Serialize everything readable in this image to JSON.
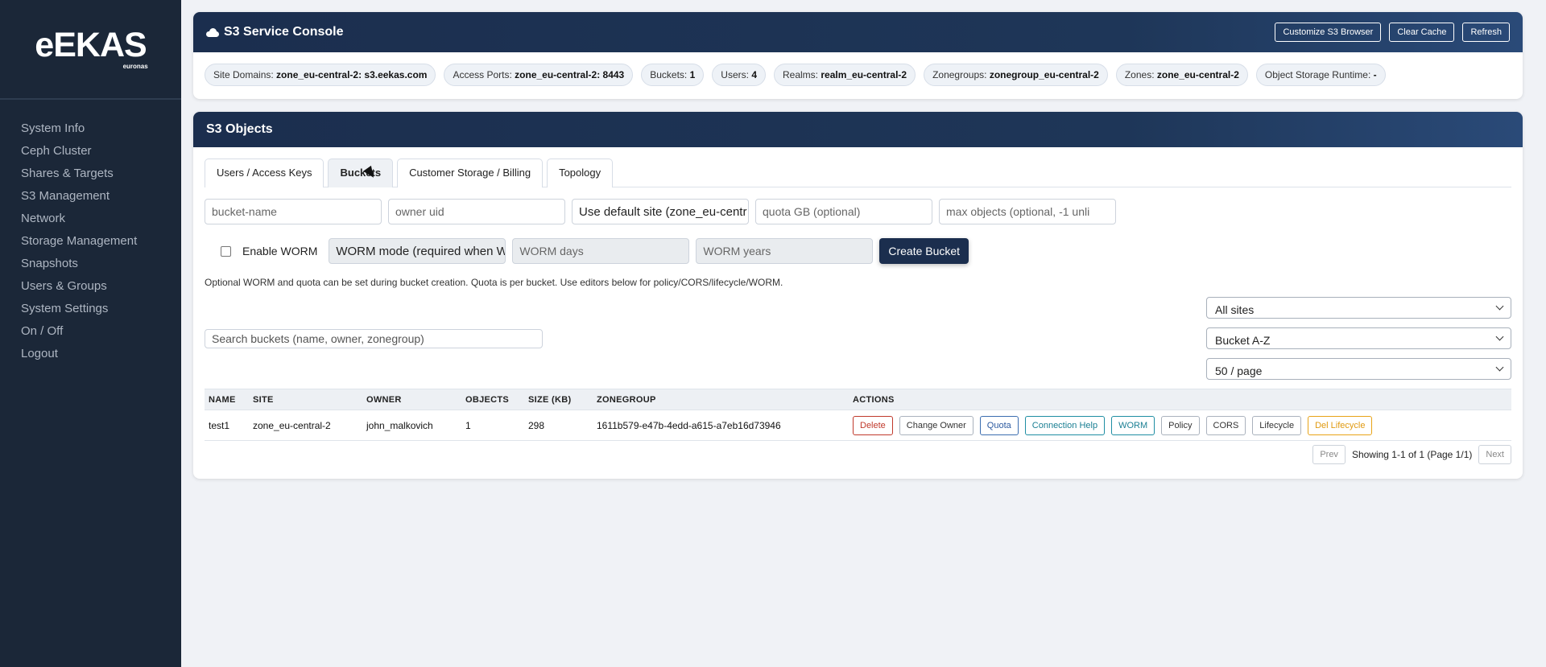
{
  "brand": {
    "logo": "eEKAS",
    "sub": "euronas"
  },
  "sidebar": {
    "items": [
      {
        "label": "System Info"
      },
      {
        "label": "Ceph Cluster"
      },
      {
        "label": "Shares & Targets"
      },
      {
        "label": "S3 Management"
      },
      {
        "label": "Network"
      },
      {
        "label": "Storage Management"
      },
      {
        "label": "Snapshots"
      },
      {
        "label": "Users & Groups"
      },
      {
        "label": "System Settings"
      },
      {
        "label": "On / Off"
      },
      {
        "label": "Logout"
      }
    ]
  },
  "console": {
    "title": "S3 Service Console",
    "buttons": {
      "customize": "Customize S3 Browser",
      "clear_cache": "Clear Cache",
      "refresh": "Refresh"
    },
    "chips": [
      {
        "label": "Site Domains:",
        "value": "zone_eu-central-2: s3.eekas.com"
      },
      {
        "label": "Access Ports:",
        "value": "zone_eu-central-2: 8443"
      },
      {
        "label": "Buckets:",
        "value": "1"
      },
      {
        "label": "Users:",
        "value": "4"
      },
      {
        "label": "Realms:",
        "value": "realm_eu-central-2"
      },
      {
        "label": "Zonegroups:",
        "value": "zonegroup_eu-central-2"
      },
      {
        "label": "Zones:",
        "value": "zone_eu-central-2"
      },
      {
        "label": "Object Storage Runtime:",
        "value": "-"
      }
    ]
  },
  "objects": {
    "title": "S3 Objects",
    "tabs": [
      "Users / Access Keys",
      "Buckets",
      "Customer Storage / Billing",
      "Topology"
    ],
    "form": {
      "bucket_name_placeholder": "bucket-name",
      "owner_placeholder": "owner uid",
      "site_select": "Use default site (zone_eu-centr",
      "quota_placeholder": "quota GB (optional)",
      "max_objects_placeholder": "max objects (optional, -1 unli",
      "worm_label": "Enable WORM",
      "worm_mode_select": "WORM mode (required when W",
      "worm_days_placeholder": "WORM days",
      "worm_years_placeholder": "WORM years",
      "create_button": "Create Bucket",
      "hint": "Optional WORM and quota can be set during bucket creation. Quota is per bucket. Use editors below for policy/CORS/lifecycle/WORM."
    },
    "search_placeholder": "Search buckets (name, owner, zonegroup)",
    "filters": {
      "site": "All sites",
      "sort": "Bucket A-Z",
      "page_size": "50 / page"
    },
    "table": {
      "headers": [
        "NAME",
        "SITE",
        "OWNER",
        "OBJECTS",
        "SIZE (KB)",
        "ZONEGROUP",
        "ACTIONS"
      ],
      "rows": [
        {
          "name": "test1",
          "site": "zone_eu-central-2",
          "owner": "john_malkovich",
          "objects": "1",
          "size": "298",
          "zonegroup": "1611b579-e47b-4edd-a615-a7eb16d73946"
        }
      ],
      "actions": [
        "Delete",
        "Change Owner",
        "Quota",
        "Connection Help",
        "WORM",
        "Policy",
        "CORS",
        "Lifecycle",
        "Del Lifecycle"
      ]
    },
    "pager": {
      "prev": "Prev",
      "status": "Showing 1-1 of 1 (Page 1/1)",
      "next": "Next"
    }
  }
}
